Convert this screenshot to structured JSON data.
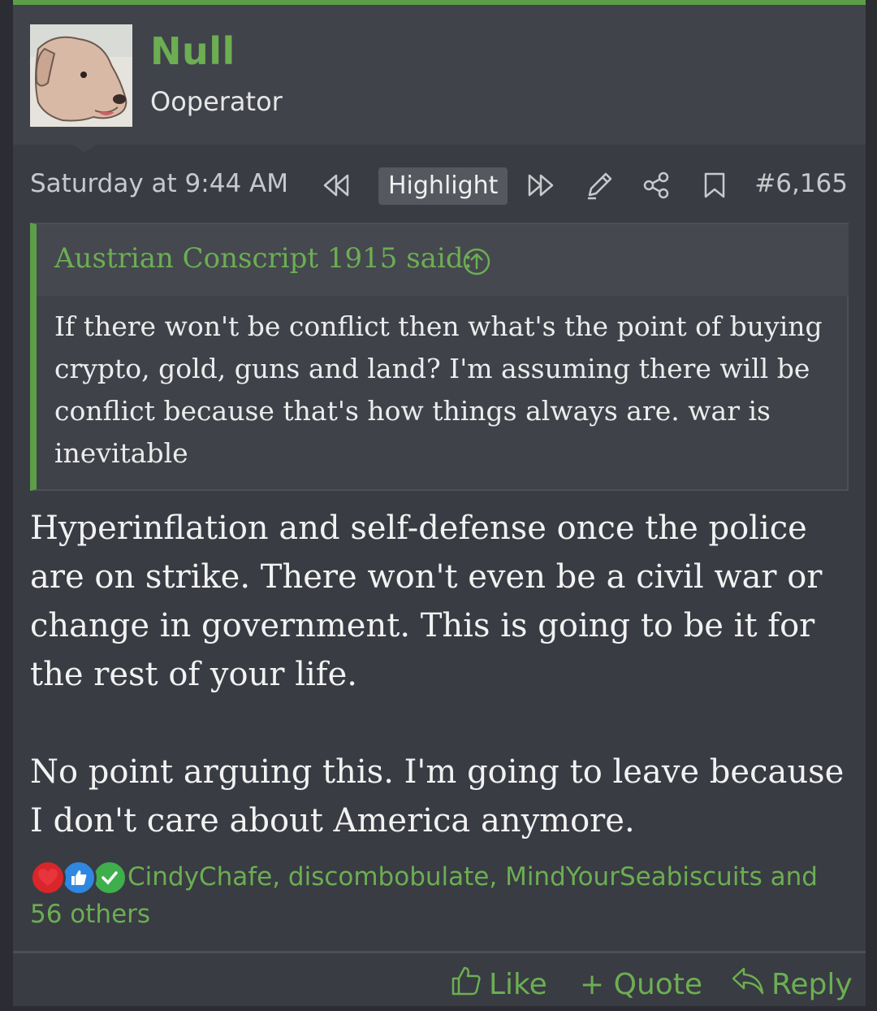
{
  "author": {
    "username": "Null",
    "title": "Ooperator"
  },
  "meta": {
    "timestamp": "Saturday at 9:44 AM",
    "highlight_label": "Highlight",
    "post_number": "#6,165"
  },
  "quote": {
    "author_line": "Austrian Conscript 1915 said:",
    "text": "If there won't be conflict then what's the point of buying crypto, gold, guns and land? I'm assuming there will be conflict because that's how things always are. war is inevitable"
  },
  "message": {
    "paragraph1": "Hyperinflation and self-defense once the police are on strike. There won't even be a civil war or change in government. This is going to be it for the rest of your life.",
    "paragraph2": "No point arguing this. I'm going to leave because I don't care about America anymore."
  },
  "reactions": {
    "users_text": "CindyChafe, discombobulate, MindYourSeabiscuits and 56 others",
    "icons": [
      "heart-icon",
      "thumbs-up-icon",
      "check-icon"
    ]
  },
  "actions": {
    "like_label": "Like",
    "quote_label": "+ Quote",
    "reply_label": "Reply"
  },
  "colors": {
    "accent": "#6cae52",
    "background": "#393c43"
  }
}
